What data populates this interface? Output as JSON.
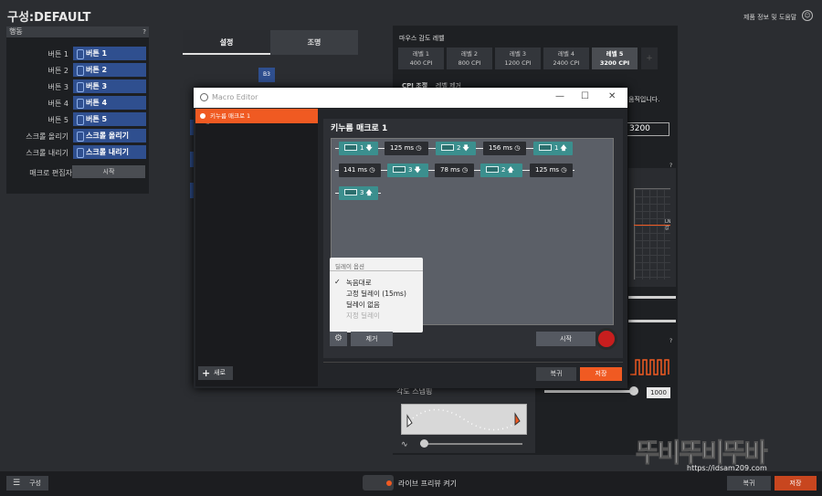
{
  "app": {
    "title": "구성:DEFAULT",
    "help_link": "제품 정보 및 도움말"
  },
  "actions_panel": {
    "header": "행동",
    "help": "?",
    "rows": [
      {
        "label": "버튼 1",
        "value": "버튼 1"
      },
      {
        "label": "버튼 2",
        "value": "버튼 2"
      },
      {
        "label": "버튼 3",
        "value": "버튼 3"
      },
      {
        "label": "버튼 4",
        "value": "버튼 4"
      },
      {
        "label": "버튼 5",
        "value": "버튼 5"
      },
      {
        "label": "스크롤 올리기",
        "value": "스크롤 올리기"
      },
      {
        "label": "스크롤 내리기",
        "value": "스크롤 내리기"
      }
    ],
    "macro_editor_label": "매크로 편집자",
    "macro_editor_start": "시작"
  },
  "tabs": {
    "settings": "설정",
    "lighting": "조명"
  },
  "b3_badge": "B3",
  "sensitivity": {
    "header": "마우스 감도 레벨",
    "levels": [
      {
        "name": "레벨 1",
        "cpi": "400 CPI"
      },
      {
        "name": "레벨 2",
        "cpi": "800 CPI"
      },
      {
        "name": "레벨 3",
        "cpi": "1200 CPI"
      },
      {
        "name": "레벨 4",
        "cpi": "2400 CPI"
      },
      {
        "name": "레벨 5",
        "cpi": "3200 CPI"
      }
    ],
    "cpi_tab": "CPI 조절",
    "level_remove_tab": "레벨 제거",
    "truncated_text": "움직입니다.",
    "cpi_value": "3200",
    "polling_value": "1000",
    "side_label": "LN\n값"
  },
  "angle_snapping": {
    "label": "각도 스냅핑"
  },
  "macro_editor": {
    "window_title": "Macro Editor",
    "macros_header": "매크로",
    "macro_items": [
      "키누름 매크로 1"
    ],
    "new_button": "새로",
    "sequence_title": "키누름 매크로 1",
    "blocks": {
      "r1": [
        "1",
        "125 ms",
        "2",
        "156 ms",
        "1"
      ],
      "r2": [
        "141 ms",
        "3",
        "78 ms",
        "2",
        "125 ms"
      ],
      "r3": [
        "3"
      ]
    },
    "delay_menu": {
      "header": "딜레이 옵션",
      "options": [
        "녹음대로",
        "고정 딜레이 (15ms)",
        "딜레이 없음",
        "지정 딜레이"
      ],
      "checked": "✓"
    },
    "remove_button": "제거",
    "start_button": "시작",
    "undo_button": "복귀",
    "save_button": "저장"
  },
  "bottom": {
    "config_button": "구성",
    "live_preview": "라이브 프리뷰 켜기",
    "undo": "복귀",
    "save": "저장"
  },
  "watermark": {
    "main": "뚜비뚜비뚜바",
    "url": "https://idsam209.com"
  }
}
